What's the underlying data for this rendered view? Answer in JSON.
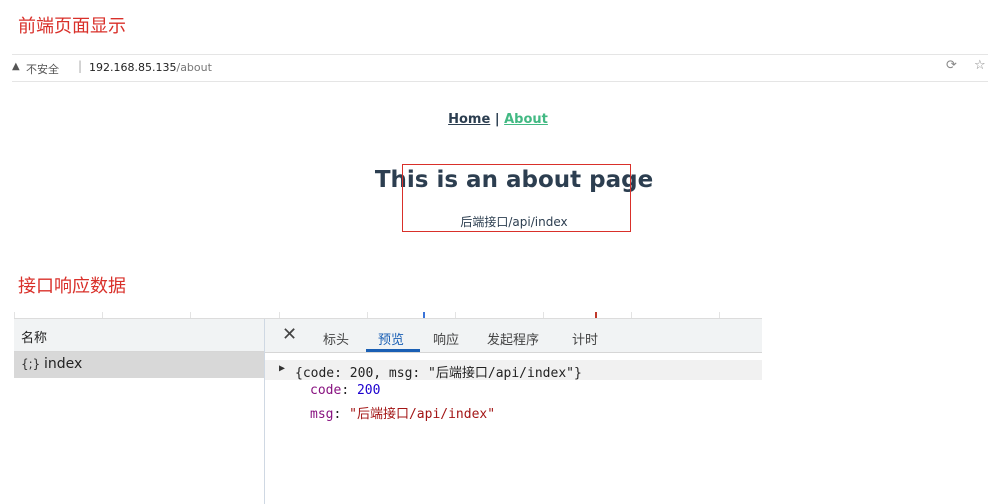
{
  "annotations": {
    "frontend_heading": "前端页面显示",
    "api_heading": "接口响应数据"
  },
  "browser": {
    "insecure_label": "不安全",
    "separator": "|",
    "url_host": "192.168.85.135",
    "url_path": "/about"
  },
  "page": {
    "nav_home": "Home",
    "nav_sep": "|",
    "nav_about": "About",
    "title": "This is an about page",
    "message": "后端接口/api/index"
  },
  "devtools": {
    "name_header": "名称",
    "request_icon": "{;}",
    "request_name": "index",
    "tabs": [
      "标头",
      "预览",
      "响应",
      "发起程序",
      "计时"
    ],
    "active_tab_index": 1,
    "summary": "{code: 200, msg: \"后端接口/api/index\"}",
    "props": {
      "code_key": "code",
      "code_value": "200",
      "msg_key": "msg",
      "msg_value": "\"后端接口/api/index\""
    }
  },
  "colors": {
    "annotation_red": "#d9302a",
    "link_green": "#42b983",
    "text_dark": "#2c3e50",
    "tab_active_blue": "#1a5fb4"
  }
}
